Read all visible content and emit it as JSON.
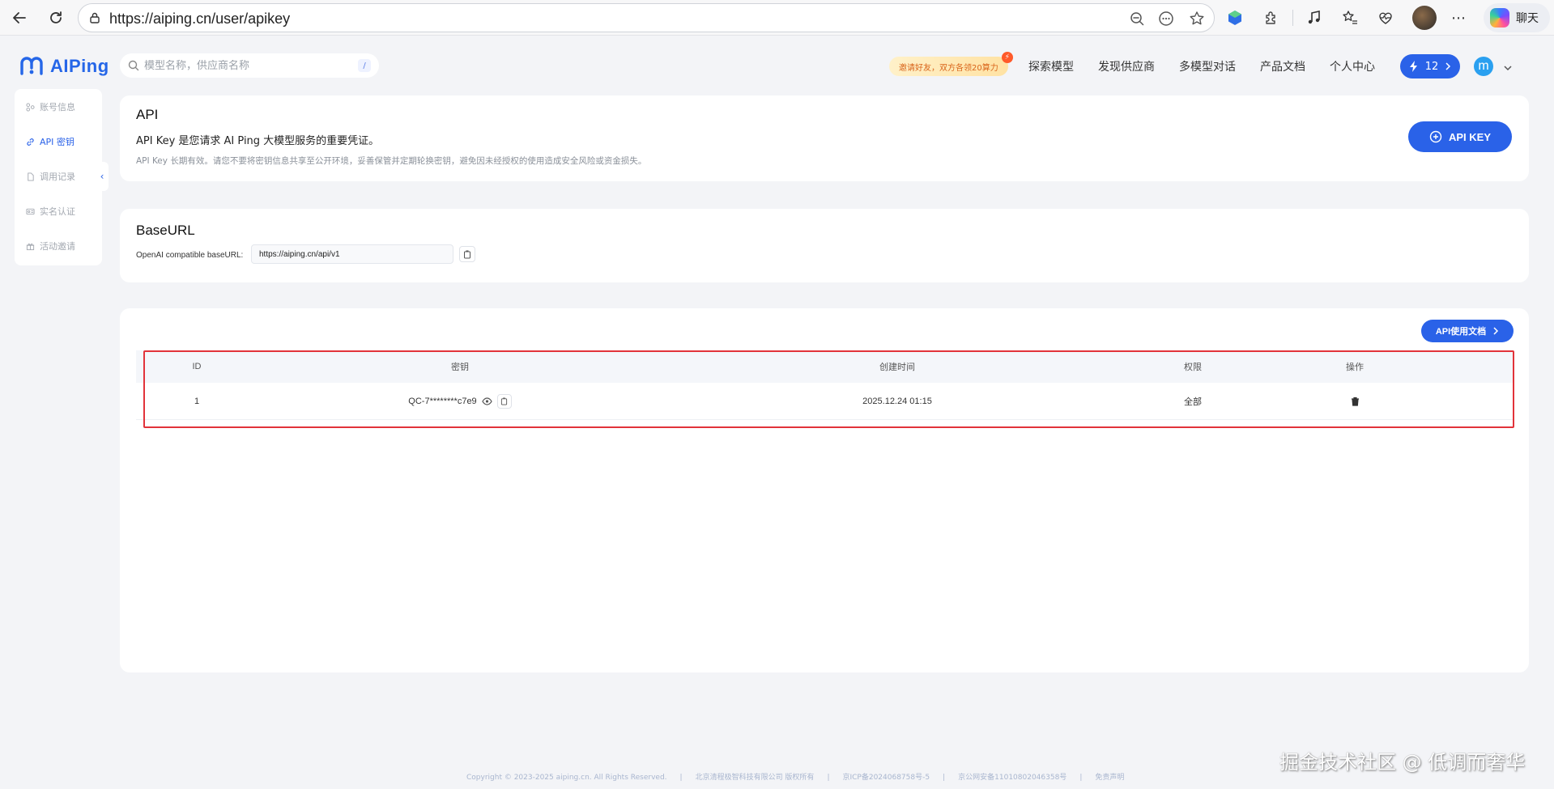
{
  "browser": {
    "url": "https://aiping.cn/user/apikey",
    "chat_label": "聊天"
  },
  "header": {
    "brand": "AIPing",
    "search_placeholder": "模型名称，供应商名称",
    "search_shortcut": "/",
    "promo": "邀请好友，双方各领20算力",
    "nav": [
      "探索模型",
      "发现供应商",
      "多模型对话",
      "产品文档",
      "个人中心"
    ],
    "credits": "12",
    "user_initial": "m"
  },
  "sidebar": {
    "items": [
      {
        "label": "账号信息",
        "icon": "account-icon",
        "active": false
      },
      {
        "label": "API 密钥",
        "icon": "link-icon",
        "active": true
      },
      {
        "label": "调用记录",
        "icon": "document-icon",
        "active": false
      },
      {
        "label": "实名认证",
        "icon": "id-card-icon",
        "active": false
      },
      {
        "label": "活动邀请",
        "icon": "gift-icon",
        "active": false
      }
    ],
    "collapse_glyph": "‹"
  },
  "api_card": {
    "title": "API",
    "description": "API Key 是您请求 AI Ping 大模型服务的重要凭证。",
    "note": "API Key 长期有效。请您不要将密钥信息共享至公开环境，妥善保管并定期轮换密钥，避免因未经授权的使用造成安全风险或资金损失。",
    "create_button": "API KEY"
  },
  "base_card": {
    "title": "BaseURL",
    "label": "OpenAI compatible baseURL:",
    "value": "https://aiping.cn/api/v1"
  },
  "keys_card": {
    "docs_button": "API使用文档",
    "columns": [
      "ID",
      "密钥",
      "创建时间",
      "权限",
      "操作"
    ],
    "rows": [
      {
        "id": "1",
        "key": "QC-7********c7e9",
        "created": "2025.12.24 01:15",
        "permission": "全部"
      }
    ]
  },
  "footer": {
    "items": [
      "Copyright © 2023-2025 aiping.cn. All Rights Reserved.",
      "北京清程极智科技有限公司 版权所有",
      "京ICP备2024068758号-5",
      "京公网安备11010802046358号",
      "免责声明"
    ],
    "separator": "|"
  },
  "watermark": "掘金技术社区 @ 低调而奢华",
  "colors": {
    "accent": "#2a62e8",
    "highlight": "#e2333a",
    "brand": "#2566e8"
  }
}
